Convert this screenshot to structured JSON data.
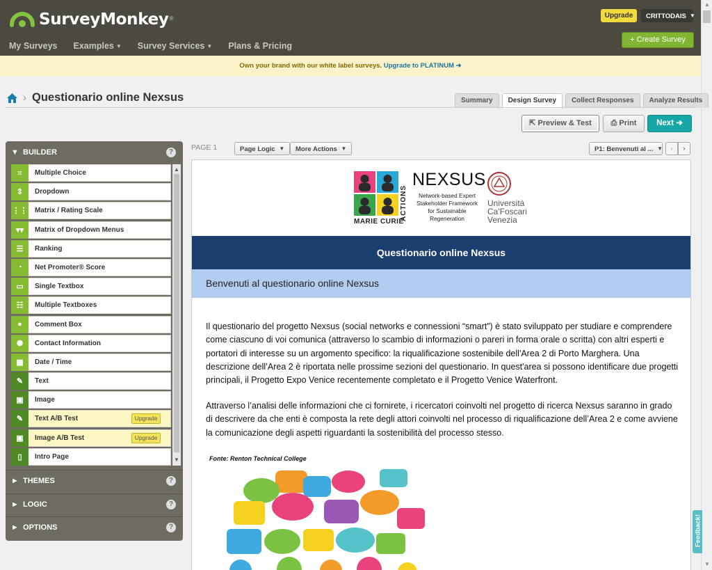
{
  "brand": {
    "name": "SurveyMonkey",
    "registered": "®"
  },
  "nav": [
    {
      "label": "My Surveys",
      "dropdown": false
    },
    {
      "label": "Examples",
      "dropdown": true
    },
    {
      "label": "Survey Services",
      "dropdown": true
    },
    {
      "label": "Plans & Pricing",
      "dropdown": false
    }
  ],
  "account": {
    "upgrade_label": "Upgrade",
    "username": "CRITTODAIS",
    "create_label": "+ Create Survey"
  },
  "promo": {
    "text": "Own your brand with our white label surveys.",
    "link": "Upgrade to PLATINUM"
  },
  "breadcrumb": {
    "title": "Questionario online Nexsus"
  },
  "tabs": [
    {
      "label": "Summary",
      "active": false
    },
    {
      "label": "Design Survey",
      "active": true
    },
    {
      "label": "Collect Responses",
      "active": false
    },
    {
      "label": "Analyze Results",
      "active": false
    }
  ],
  "actions": {
    "preview": "Preview & Test",
    "print": "Print",
    "next": "Next"
  },
  "builder": {
    "title": "BUILDER",
    "help": "?",
    "items": [
      {
        "label": "Multiple Choice",
        "icon": "list-icon",
        "glyph": "≡"
      },
      {
        "label": "Dropdown",
        "icon": "dropdown-icon",
        "glyph": "⇕"
      },
      {
        "label": "Matrix / Rating Scale",
        "icon": "matrix-icon",
        "glyph": "⋮⋮"
      },
      {
        "label": "Matrix of Dropdown Menus",
        "icon": "matrix-dropdown-icon",
        "glyph": "▾▾"
      },
      {
        "label": "Ranking",
        "icon": "ranking-icon",
        "glyph": "☰"
      },
      {
        "label": "Net Promoter® Score",
        "icon": "gauge-icon",
        "glyph": "◔"
      },
      {
        "label": "Single Textbox",
        "icon": "textbox-icon",
        "glyph": "▭"
      },
      {
        "label": "Multiple Textboxes",
        "icon": "textboxes-icon",
        "glyph": "☷"
      },
      {
        "label": "Comment Box",
        "icon": "comment-icon",
        "glyph": "●"
      },
      {
        "label": "Contact Information",
        "icon": "person-icon",
        "glyph": "⚉"
      },
      {
        "label": "Date / Time",
        "icon": "calendar-icon",
        "glyph": "▦"
      },
      {
        "label": "Text",
        "icon": "edit-icon",
        "glyph": "✎"
      },
      {
        "label": "Image",
        "icon": "image-icon",
        "glyph": "▣"
      },
      {
        "label": "Text A/B Test",
        "icon": "edit-icon",
        "glyph": "✎",
        "upgrade": "Upgrade"
      },
      {
        "label": "Image A/B Test",
        "icon": "image-icon",
        "glyph": "▣",
        "upgrade": "Upgrade"
      },
      {
        "label": "Intro Page",
        "icon": "page-icon",
        "glyph": "▯"
      }
    ]
  },
  "sections": [
    {
      "label": "THEMES",
      "help": "?"
    },
    {
      "label": "LOGIC",
      "help": "?"
    },
    {
      "label": "OPTIONS",
      "help": "?"
    }
  ],
  "page_toolbar": {
    "page": "PAGE 1",
    "page_logic": "Page Logic",
    "more_actions": "More Actions",
    "page_select": "P1: Benvenuti al ..."
  },
  "survey": {
    "logo": {
      "project": "NEXSUS",
      "project_sub": "Network-based Expert Stakeholder Framework for Sustainable Regeneration",
      "mc_side": "ACTIONS",
      "mc_bottom": "MARIE CURIE",
      "university": [
        "Università",
        "Ca'Foscari",
        "Venezia"
      ]
    },
    "title": "Questionario online Nexsus",
    "page_title": "Benvenuti al questionario online Nexsus",
    "paragraphs": [
      "Il questionario del progetto Nexsus (social networks e connessioni “smart”) è stato sviluppato per studiare e comprendere come ciascuno di voi comunica (attraverso lo scambio di informazioni o pareri in forma orale o scritta) con altri esperti e portatori di interesse su un argomento specifico: la riqualificazione sostenibile dell'Area 2 di Porto Marghera. Una descrizione dell’Area 2 è riportata nelle prossime sezioni del questionario. In quest'area si possono identificare due progetti principali, il Progetto Expo Venice recentemente completato e il Progetto Venice Waterfront.",
      "Attraverso l’analisi delle informazioni che ci fornirete, i ricercatori coinvolti nel progetto di ricerca Nexsus saranno in grado di descrivere da che enti è composta la rete degli attori coinvolti nel processo di riqualificazione dell’Area 2 e come avviene la comunicazione degli aspetti riguardanti la sostenibilità del processo stesso."
    ],
    "source": "Fonte: Renton Technical College"
  },
  "feedback": "Feedback!",
  "colors": {
    "topbar": "#4b4940",
    "green": "#84bb33",
    "teal": "#17a7a7",
    "navy": "#1c3e6e",
    "light_blue": "#b3cdf0",
    "promo": "#fcf2c9"
  }
}
